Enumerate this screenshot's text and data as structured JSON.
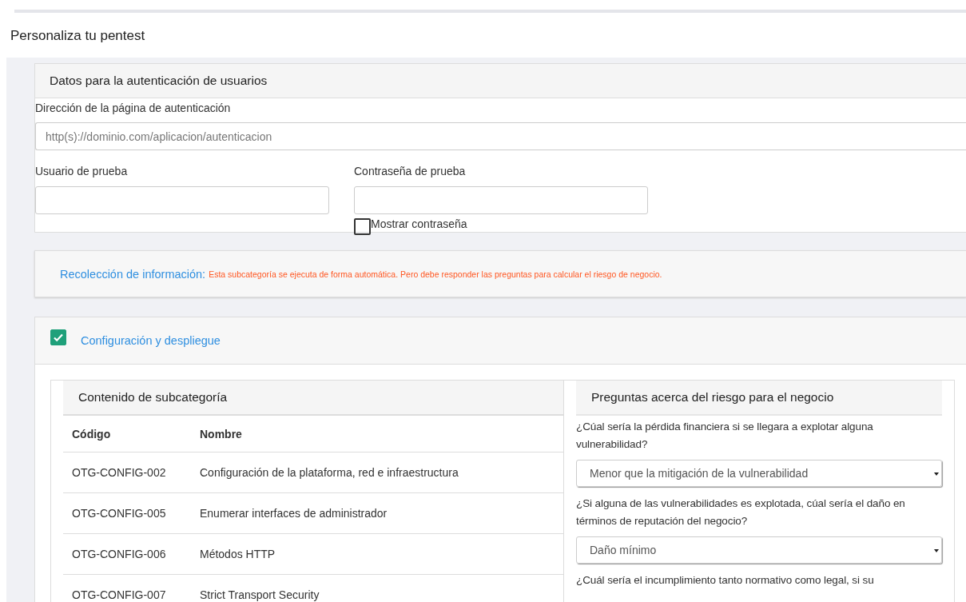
{
  "page_title": "Personaliza tu pentest",
  "auth": {
    "title": "Datos para la autenticación de usuarios",
    "url_field": {
      "label": "Dirección de la página de autenticación",
      "placeholder": "http(s)://dominio.com/aplicacion/autenticacion"
    },
    "user_field": {
      "label": "Usuario de prueba"
    },
    "password_field": {
      "label": "Contraseña de prueba"
    },
    "show_password": {
      "label": "Mostrar contraseña",
      "checked": false
    }
  },
  "info": {
    "title": "Recolección de información:",
    "note": "Esta subcategoría se ejecuta de forma automática. Pero debe responder las preguntas para calcular el riesgo de negocio."
  },
  "category": {
    "title": "Configuración y despliegue",
    "checked": true,
    "content": {
      "title": "Contenido de subcategoría",
      "columns": [
        "Código",
        "Nombre"
      ],
      "rows": [
        [
          "OTG-CONFIG-002",
          "Configuración de la plataforma, red e infraestructura"
        ],
        [
          "OTG-CONFIG-005",
          "Enumerar interfaces de administrador"
        ],
        [
          "OTG-CONFIG-006",
          "Métodos HTTP"
        ],
        [
          "OTG-CONFIG-007",
          "Strict Transport Security"
        ]
      ]
    },
    "questions": {
      "title": "Preguntas acerca del riesgo para el negocio",
      "items": [
        {
          "question": "¿Cúal sería la pérdida financiera si se llegara a explotar alguna vulnerabilidad?",
          "answer": "Menor que la mitigación de la vulnerabilidad"
        },
        {
          "question": "¿Si alguna de las vulnerabilidades es explotada, cúal sería el daño en términos de reputación del negocio?",
          "answer": "Daño mínimo"
        },
        {
          "question": "¿Cuál sería el incumplimiento tanto normativo como legal, si su"
        }
      ]
    }
  }
}
